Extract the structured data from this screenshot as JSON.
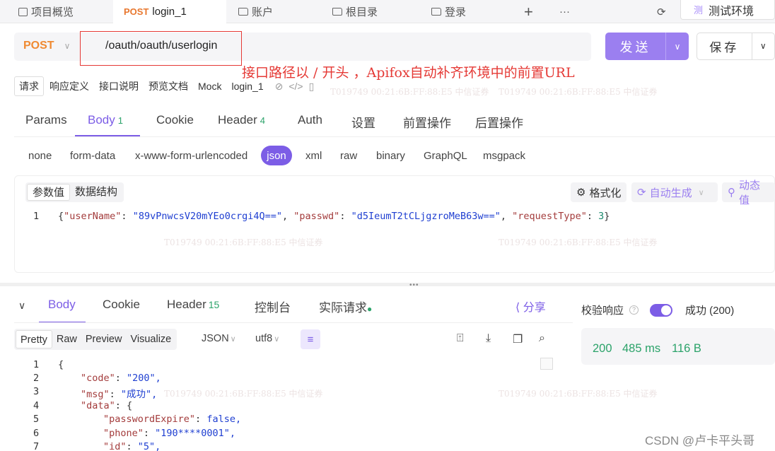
{
  "tabs": [
    {
      "label": "项目概览",
      "icon": "square-icon"
    },
    {
      "method": "POST",
      "label": "login_1",
      "active": true
    },
    {
      "label": "账户",
      "icon": "folder-icon"
    },
    {
      "label": "根目录",
      "icon": "folder-icon"
    },
    {
      "label": "登录",
      "icon": "folder-icon"
    }
  ],
  "tab_add": "+",
  "tab_more": "···",
  "environment": {
    "tag": "测",
    "label": "测试环境"
  },
  "request": {
    "method": "POST",
    "url": "/oauth/oauth/userlogin",
    "send_label": "发送",
    "save_label": "保存"
  },
  "annotation": "接口路径以 / 开头 ，Apifox自动补齐环境中的前置URL",
  "sub_tabs": [
    "请求",
    "响应定义",
    "接口说明",
    "预览文档",
    "Mock",
    "login_1"
  ],
  "param_tabs": [
    {
      "label": "Params"
    },
    {
      "label": "Body",
      "count": "1",
      "active": true
    },
    {
      "label": "Cookie"
    },
    {
      "label": "Header",
      "count": "4"
    },
    {
      "label": "Auth"
    },
    {
      "label": "设置"
    },
    {
      "label": "前置操作"
    },
    {
      "label": "后置操作"
    }
  ],
  "body_types": [
    "none",
    "form-data",
    "x-www-form-urlencoded",
    "json",
    "xml",
    "raw",
    "binary",
    "GraphQL",
    "msgpack"
  ],
  "editor": {
    "mode_tabs": [
      "参数值",
      "数据结构"
    ],
    "format_label": "格式化",
    "autogen_label": "自动生成",
    "dynamic_label": "动态值",
    "line_no": "1",
    "body": {
      "k1": "\"userName\"",
      "v1": "\"89vPnwcsV20mYEo0crgi4Q==\"",
      "k2": "\"passwd\"",
      "v2": "\"d5IeumT2tCLjgzroMeB63w==\"",
      "k3": "\"requestType\"",
      "v3": "3"
    }
  },
  "response": {
    "tabs": [
      {
        "label": "Body",
        "active": true
      },
      {
        "label": "Cookie"
      },
      {
        "label": "Header",
        "count": "15"
      },
      {
        "label": "控制台"
      },
      {
        "label": "实际请求"
      }
    ],
    "share_label": "分享",
    "view_modes": [
      "Pretty",
      "Raw",
      "Preview",
      "Visualize"
    ],
    "format": "JSON",
    "encoding": "utf8",
    "lines": [
      {
        "n": "1",
        "t": "{"
      },
      {
        "n": "2",
        "k": "\"code\"",
        "v": "\"200\","
      },
      {
        "n": "3",
        "k": "\"msg\"",
        "v": "\"成功\","
      },
      {
        "n": "4",
        "k": "\"data\"",
        "v": "{"
      },
      {
        "n": "5",
        "k": "\"passwordExpire\"",
        "v": "false,"
      },
      {
        "n": "6",
        "k": "\"phone\"",
        "v": "\"190****0001\","
      },
      {
        "n": "7",
        "k": "\"id\"",
        "v": "\"5\","
      }
    ],
    "verify_label": "校验响应",
    "verify_result": "成功 (200)",
    "status": "200",
    "time": "485 ms",
    "size": "116 B"
  },
  "watermark": "T019749  00:21:6B:FF:88:E5  中信证券",
  "csdn": "CSDN @卢卡平头哥",
  "colors": {
    "accent": "#7c5de6",
    "method": "#f08a32",
    "annotation": "#e53935",
    "success": "#2ca36a"
  }
}
